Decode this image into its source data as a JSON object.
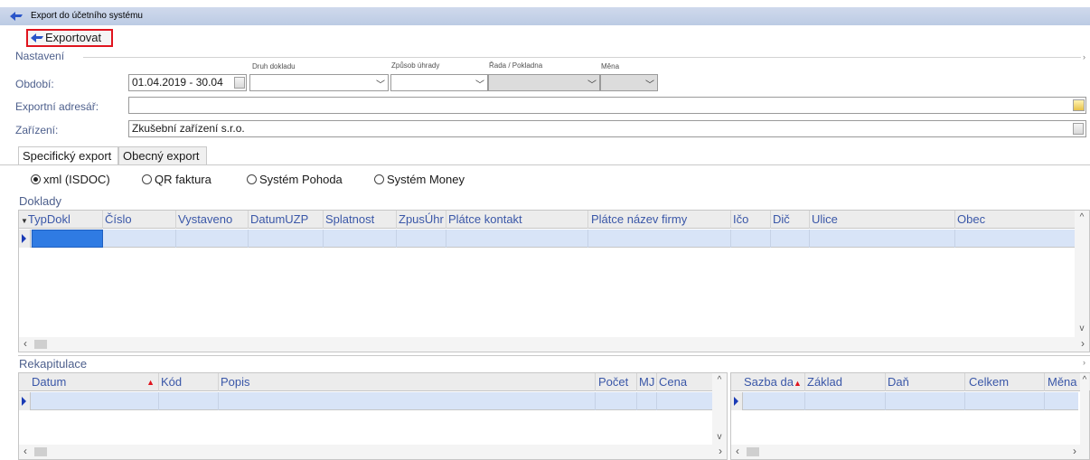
{
  "window": {
    "title": "Export do účetního systému",
    "icon": "arrow-icon"
  },
  "toolbar": {
    "export_label": "Exportovat"
  },
  "settings": {
    "section_label": "Nastavení",
    "period_label": "Období:",
    "period_value": "01.04.2019 - 30.04",
    "druh_label": "Druh dokladu",
    "zpusob_label": "Způsob úhrady",
    "rada_label": "Řada / Pokladna",
    "mena_label": "Měna",
    "export_dir_label": "Exportní adresář:",
    "export_dir_value": "",
    "device_label": "Zařízení:",
    "device_value": "Zkušební zařízení s.r.o."
  },
  "tabs": [
    {
      "label": "Specifický export",
      "active": true
    },
    {
      "label": "Obecný export",
      "active": false
    }
  ],
  "radios": [
    {
      "label": "xml (ISDOC)",
      "checked": true
    },
    {
      "label": "QR faktura",
      "checked": false
    },
    {
      "label": "Systém Pohoda",
      "checked": false
    },
    {
      "label": "Systém Money",
      "checked": false
    }
  ],
  "doklady": {
    "title": "Doklady",
    "columns": [
      "TypDokl",
      "Číslo",
      "Vystaveno",
      "DatumUZP",
      "Splatnost",
      "ZpusÚhr",
      "Plátce kontakt",
      "Plátce název firmy",
      "Ičo",
      "Dič",
      "Ulice",
      "Obec"
    ]
  },
  "rekapitulace": {
    "title": "Rekapitulace",
    "left_columns": [
      "Datum",
      "Kód",
      "Popis",
      "Počet",
      "MJ",
      "Cena"
    ],
    "right_columns": [
      "Sazba da",
      "Základ",
      "Daň",
      "Celkem",
      "Měna"
    ]
  },
  "colors": {
    "accent": "#4d5f8c",
    "header_text": "#3a57a8",
    "selected_row": "#d8e4f7",
    "highlight_box": "#e0141e"
  }
}
